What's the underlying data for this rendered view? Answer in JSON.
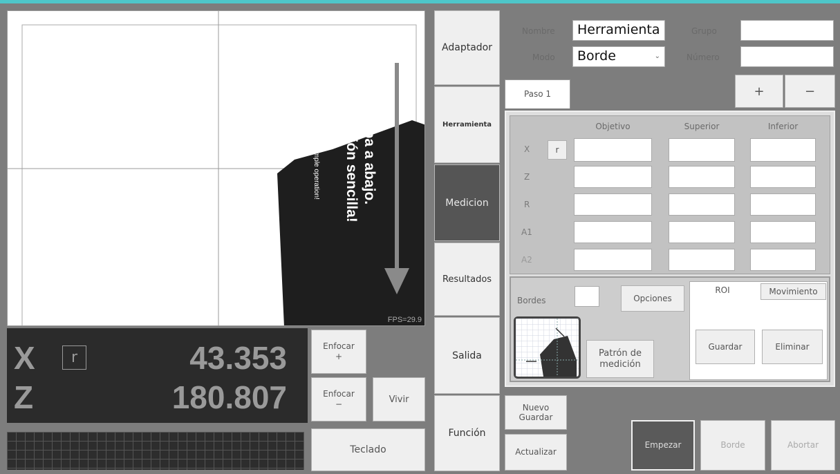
{
  "camera": {
    "overlay_title_line1": "De arriba a abajo.",
    "overlay_title_line2": "¡Operación sencilla!",
    "overlay_subtitle": "From top to bottom. Simple operation!",
    "fps": "FPS=29.9"
  },
  "readout": {
    "x_label": "X",
    "z_label": "Z",
    "r_label": "r",
    "x_value": "43.353",
    "z_value": "180.807"
  },
  "controls": {
    "focus_plus": "Enfocar\n+",
    "focus_minus": "Enfocar\n−",
    "live": "Vivir",
    "keyboard": "Teclado"
  },
  "tabs": [
    "Adaptador",
    "Herramienta",
    "Medicion",
    "Resultados",
    "Salida",
    "Función"
  ],
  "header": {
    "name_label": "Nombre",
    "name_value": "Herramienta",
    "group_label": "Grupo",
    "group_value": "",
    "mode_label": "Modo",
    "mode_value": "Borde",
    "number_label": "Número",
    "number_value": ""
  },
  "steps": {
    "step_tab": "Paso 1",
    "add": "+",
    "remove": "−"
  },
  "measurement": {
    "columns": [
      "Objetivo",
      "Superior",
      "Inferior"
    ],
    "rows": [
      "X",
      "Z",
      "R",
      "A1",
      "A2"
    ],
    "r_toggle": "r"
  },
  "edges": {
    "label": "Bordes",
    "options": "Opciones",
    "pattern": "Patrón de\nmedición",
    "roi_label": "ROI",
    "movement": "Movimiento",
    "save": "Guardar",
    "delete": "Eliminar"
  },
  "actions": {
    "new_save": "Nuevo\nGuardar",
    "update": "Actualizar",
    "start": "Empezar",
    "edge": "Borde",
    "abort": "Abortar"
  }
}
